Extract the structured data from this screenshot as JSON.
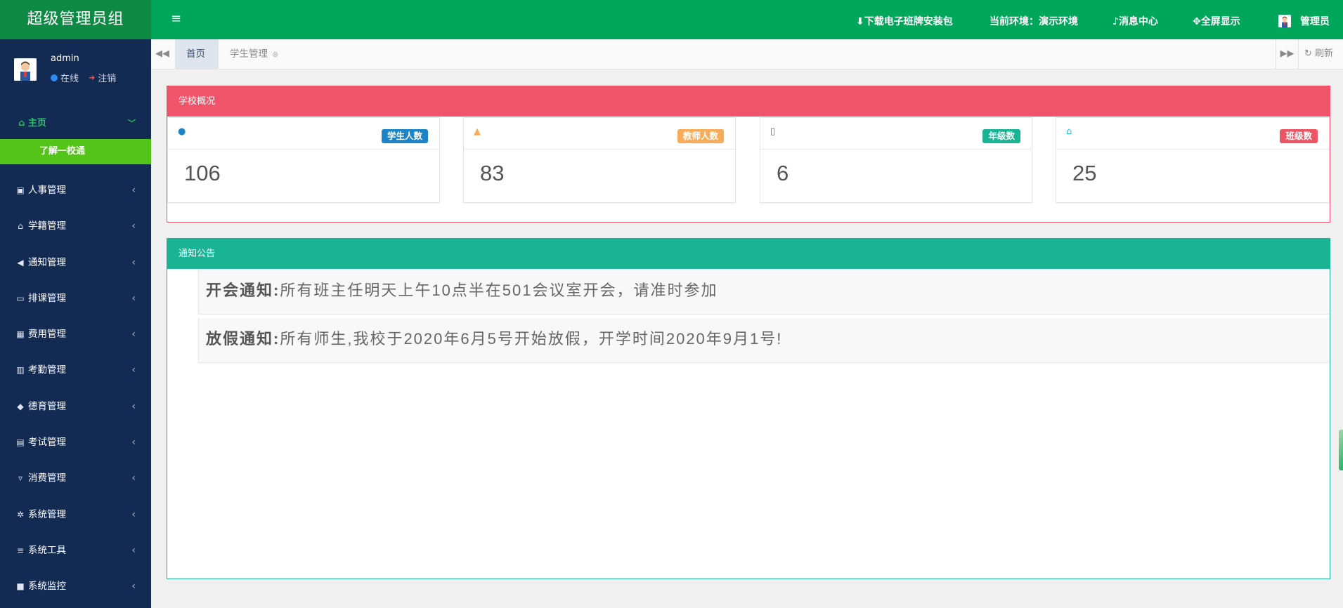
{
  "app": {
    "brand": "超级管理员组"
  },
  "user": {
    "name": "admin",
    "online_label": "在线",
    "logout_label": "注销"
  },
  "sidebar": {
    "home_label": "主页",
    "home_sub_active": "了解一校通",
    "items": [
      {
        "icon": "id-card-icon",
        "label": "人事管理"
      },
      {
        "icon": "bank-icon",
        "label": "学籍管理"
      },
      {
        "icon": "bullhorn-icon",
        "label": "通知管理"
      },
      {
        "icon": "calendar-icon",
        "label": "排课管理"
      },
      {
        "icon": "calculator-icon",
        "label": "费用管理"
      },
      {
        "icon": "bar-chart-icon",
        "label": "考勤管理"
      },
      {
        "icon": "graduation-cap-icon",
        "label": "德育管理"
      },
      {
        "icon": "newspaper-icon",
        "label": "考试管理"
      },
      {
        "icon": "basket-icon",
        "label": "消费管理"
      },
      {
        "icon": "gear-icon",
        "label": "系统管理"
      },
      {
        "icon": "list-icon",
        "label": "系统工具"
      },
      {
        "icon": "video-icon",
        "label": "系统监控"
      }
    ]
  },
  "header": {
    "download_label": "下载电子班牌安装包",
    "env_label": "当前环境：演示环境",
    "messages_label": "消息中心",
    "fullscreen_label": "全屏显示",
    "admin_label": "管理员"
  },
  "tabs": {
    "home": "首页",
    "student": "学生管理",
    "refresh": "刷新"
  },
  "school_overview": {
    "title": "学校概况",
    "stats": [
      {
        "badge": "学生人数",
        "value": "106",
        "badge_color": "#1c84c6",
        "icon": "user-icon",
        "icon_color": "#1c84c6"
      },
      {
        "badge": "教师人数",
        "value": "83",
        "badge_color": "#f8ac59",
        "icon": "teacher-icon",
        "icon_color": "#f8ac59"
      },
      {
        "badge": "年级数",
        "value": "6",
        "badge_color": "#1ab394",
        "icon": "tablet-icon",
        "icon_color": "#666666"
      },
      {
        "badge": "班级数",
        "value": "25",
        "badge_color": "#ed5565",
        "icon": "bank-icon",
        "icon_color": "#23c6c8"
      }
    ]
  },
  "notices": {
    "title": "通知公告",
    "items": [
      {
        "label": "开会通知:",
        "text": "所有班主任明天上午10点半在501会议室开会，请准时参加"
      },
      {
        "label": "放假通知:",
        "text": "所有师生,我校于2020年6月5号开始放假，开学时间2020年9月1号!"
      }
    ]
  },
  "colors": {
    "sidebar_bg": "#132a52",
    "topbar_bg": "#00a65a",
    "overview_accent": "#f0546a",
    "notice_accent": "#1ab394",
    "active_sub_bg": "#54c41a"
  }
}
